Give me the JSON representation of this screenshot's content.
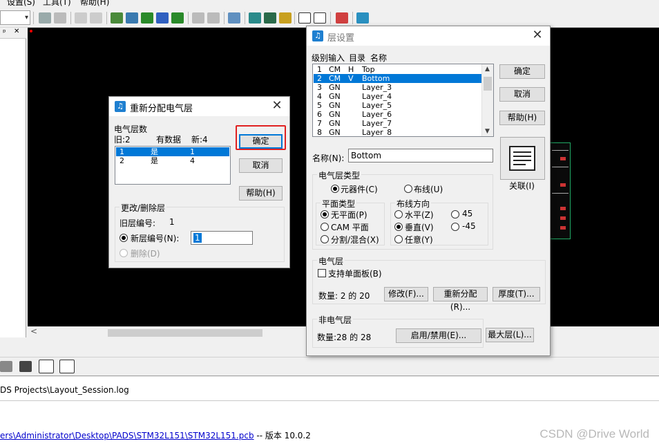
{
  "menu": {
    "items": [
      "设置(S)",
      "工具(T)",
      "帮助(H)"
    ]
  },
  "left_panel": {
    "pin_label": "ᵖ",
    "close_label": "✕"
  },
  "log": {
    "line1": "DS Projects\\Layout_Session.log",
    "path_link": "ers\\Administrator\\Desktop\\PADS\\STM32L151\\STM32L151.pcb",
    "version_text": " -- 版本  10.0.2"
  },
  "watermark": "CSDN @Drive World",
  "reassign_dialog": {
    "title": "重新分配电气层",
    "count_label": "电气层数",
    "old_label": "旧:2",
    "has_data_label": "有数据",
    "new_label": "新:4",
    "rows": [
      {
        "old": "1",
        "has_data": "是",
        "new": "1",
        "selected": true
      },
      {
        "old": "2",
        "has_data": "是",
        "new": "4",
        "selected": false
      }
    ],
    "ok": "确定",
    "cancel": "取消",
    "help": "帮助(H)",
    "group_title": "更改/删除层",
    "old_num_label": "旧层编号:",
    "old_num_value": "1",
    "new_num_label": "新层编号(N):",
    "new_num_value": "1",
    "delete_label": "删除(D)"
  },
  "layer_dialog": {
    "title": "层设置",
    "list_header": [
      "级别输入",
      "目录",
      "名称"
    ],
    "layers": [
      {
        "num": "1",
        "type": "CM",
        "dir": "H",
        "name": "Top",
        "selected": false
      },
      {
        "num": "2",
        "type": "CM",
        "dir": "V",
        "name": "Bottom",
        "selected": true
      },
      {
        "num": "3",
        "type": "GN",
        "dir": "",
        "name": "Layer_3",
        "selected": false
      },
      {
        "num": "4",
        "type": "GN",
        "dir": "",
        "name": "Layer_4",
        "selected": false
      },
      {
        "num": "5",
        "type": "GN",
        "dir": "",
        "name": "Layer_5",
        "selected": false
      },
      {
        "num": "6",
        "type": "GN",
        "dir": "",
        "name": "Layer_6",
        "selected": false
      },
      {
        "num": "7",
        "type": "GN",
        "dir": "",
        "name": "Layer_7",
        "selected": false
      },
      {
        "num": "8",
        "type": "GN",
        "dir": "",
        "name": "Layer_8",
        "selected": false
      }
    ],
    "ok": "确定",
    "cancel": "取消",
    "help": "帮助(H)",
    "about": "关联(I)",
    "name_label": "名称(N):",
    "name_value": "Bottom",
    "elec_type_title": "电气层类型",
    "component_label": "元器件(C)",
    "routing_label": "布线(U)",
    "plane_title": "平面类型",
    "no_plane": "无平面(P)",
    "cam_plane": "CAM 平面",
    "split_mixed": "分割/混合(X)",
    "route_dir_title": "布线方向",
    "horizontal": "水平(Z)",
    "vertical": "垂直(V)",
    "any": "任意(Y)",
    "deg45": "45",
    "degm45": "-45",
    "elec_layer_title": "电气层",
    "single_sided": "支持单面板(B)",
    "count_text": "数量: 2 的 20",
    "modify": "修改(F)...",
    "reassign": "重新分配(R)...",
    "thickness": "厚度(T)...",
    "non_elec_title": "非电气层",
    "non_elec_count": "数量:28 的 28",
    "enable_disable": "启用/禁用(E)...",
    "max_layers": "最大层(L)..."
  }
}
